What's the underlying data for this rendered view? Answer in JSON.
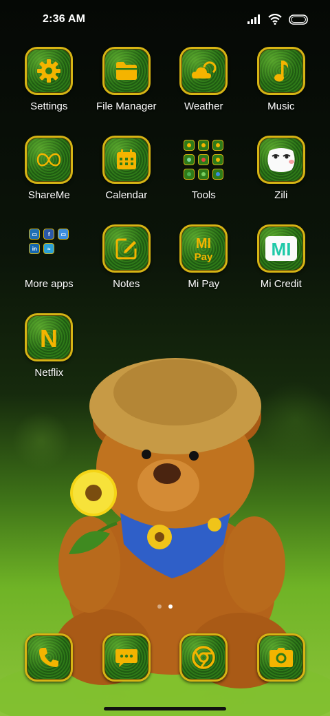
{
  "status_bar": {
    "time": "2:36 AM",
    "icons": [
      "signal-icon",
      "wifi-icon",
      "battery-icon"
    ]
  },
  "apps": [
    {
      "label": "Settings",
      "icon": "gear-icon"
    },
    {
      "label": "File Manager",
      "icon": "folder-icon"
    },
    {
      "label": "Weather",
      "icon": "cloud-sun-icon"
    },
    {
      "label": "Music",
      "icon": "music-note-icon"
    },
    {
      "label": "ShareMe",
      "icon": "shareme-icon"
    },
    {
      "label": "Calendar",
      "icon": "calendar-icon"
    },
    {
      "label": "Tools",
      "icon": "tools-folder-icon"
    },
    {
      "label": "Zili",
      "icon": "zili-face-icon"
    },
    {
      "label": "More apps",
      "icon": "more-apps-folder-icon"
    },
    {
      "label": "Notes",
      "icon": "notes-pen-icon"
    },
    {
      "label": "Mi Pay",
      "icon": "mi-pay-icon",
      "text": "Mi Pay"
    },
    {
      "label": "Mi Credit",
      "icon": "mi-credit-icon",
      "text": "MI"
    },
    {
      "label": "Netflix",
      "icon": "netflix-icon",
      "text": "N"
    }
  ],
  "dock": [
    {
      "name": "phone",
      "icon": "phone-icon"
    },
    {
      "name": "messages",
      "icon": "message-icon"
    },
    {
      "name": "chrome",
      "icon": "chrome-icon"
    },
    {
      "name": "camera",
      "icon": "camera-icon"
    }
  ],
  "page_indicator": {
    "pages": 2,
    "current": 2
  },
  "colors": {
    "accent_gold": "#f4b400",
    "tile_border": "#d6b414",
    "tile_green": "#2e7a18",
    "label_text": "#ffffff"
  }
}
